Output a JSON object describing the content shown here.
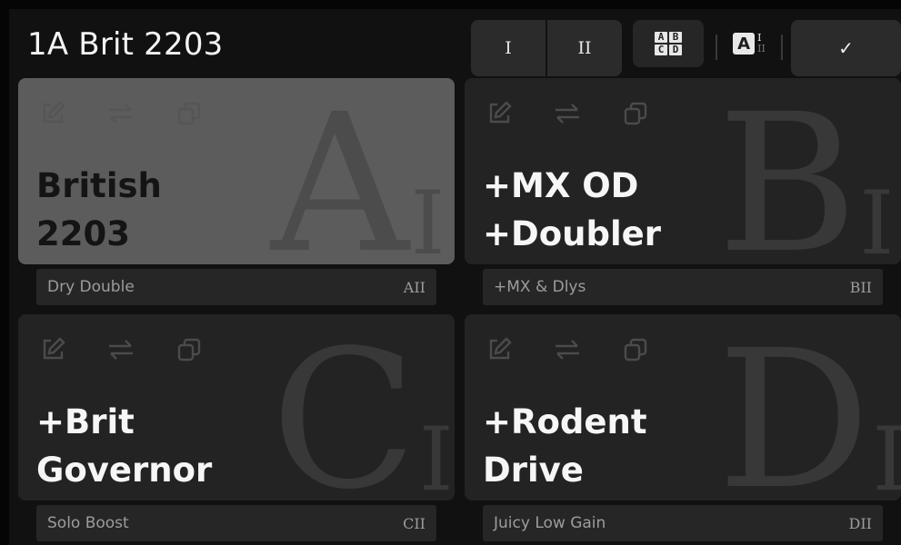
{
  "header": {
    "title": "1A Brit 2203",
    "toggle": {
      "option_1": "I",
      "option_2": "II"
    },
    "grid_icon_letters": [
      "A",
      "B",
      "C",
      "D"
    ],
    "ai_icon": {
      "letter": "A",
      "roman_top": "I",
      "roman_bottom": "II"
    },
    "confirm_icon": "check-icon"
  },
  "cards": [
    {
      "name_line1": "British",
      "name_line2": "2203",
      "letter": "A",
      "roman": "I",
      "sub_label": "Dry Double",
      "sub_code": "AII",
      "active": true
    },
    {
      "name_line1": "+MX OD",
      "name_line2": "+Doubler",
      "letter": "B",
      "roman": "I",
      "sub_label": "+MX & Dlys",
      "sub_code": "BII",
      "active": false
    },
    {
      "name_line1": "+Brit",
      "name_line2": "Governor",
      "letter": "C",
      "roman": "I",
      "sub_label": "Solo Boost",
      "sub_code": "CII",
      "active": false
    },
    {
      "name_line1": "+Rodent",
      "name_line2": "Drive",
      "letter": "D",
      "roman": "I",
      "sub_label": "Juicy Low Gain",
      "sub_code": "DII",
      "active": false
    }
  ],
  "card_icons": [
    "edit-icon",
    "swap-icon",
    "copy-icon"
  ],
  "colors": {
    "background": "#111111",
    "card": "#232323",
    "card_active": "#5c5c5c",
    "text": "#f6f6f6"
  }
}
